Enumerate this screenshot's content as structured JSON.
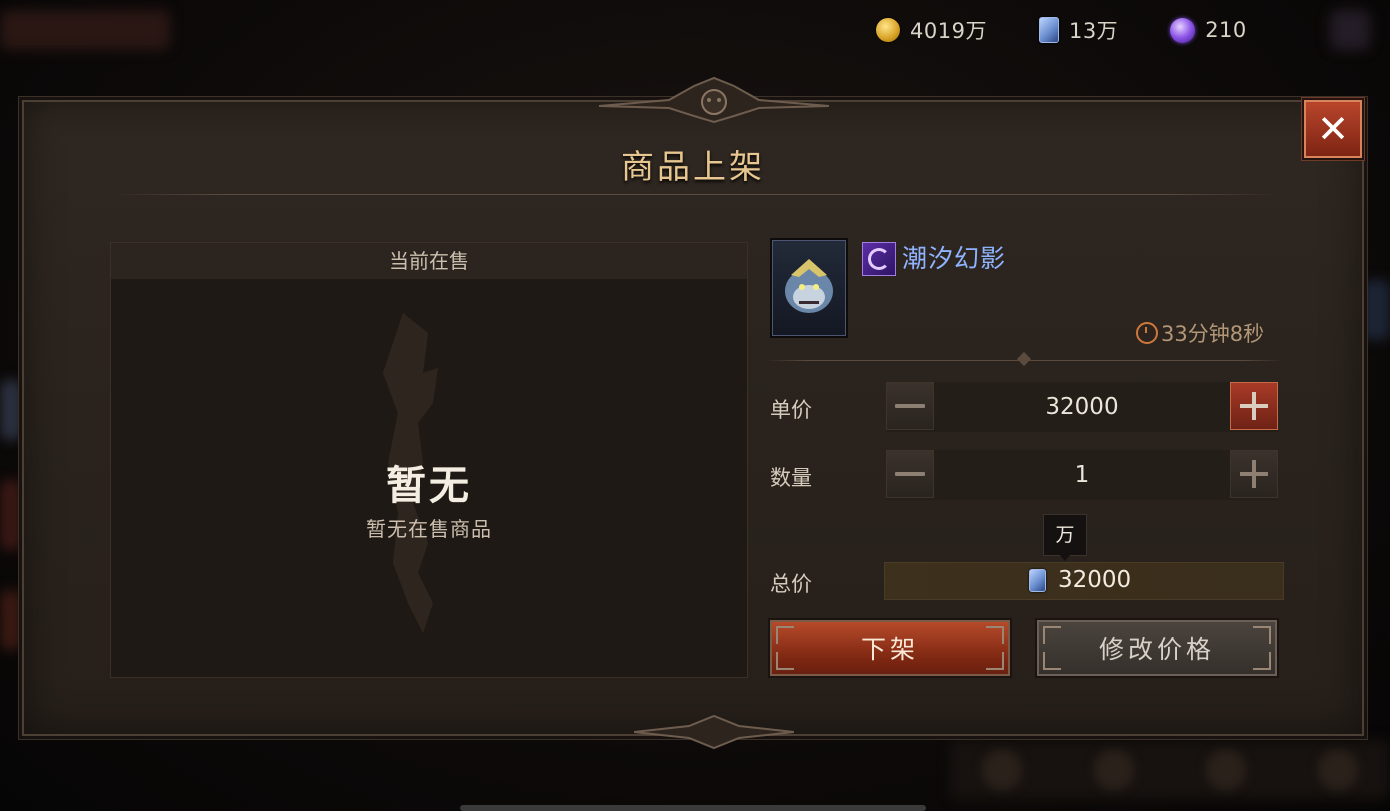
{
  "currencies": [
    {
      "icon": "gold-coin-icon",
      "value": "4019万"
    },
    {
      "icon": "card-currency-icon",
      "value": "13万"
    },
    {
      "icon": "purple-orb-icon",
      "value": "210"
    }
  ],
  "dialog": {
    "title": "商品上架",
    "close_icon": "close-icon",
    "close_label": "✕"
  },
  "current_sale": {
    "header": "当前在售",
    "empty_title": "暂无",
    "empty_subtitle": "暂无在售商品"
  },
  "item": {
    "name": "潮汐幻影",
    "name_color": "#8fb3ff",
    "rarity_icon": "purple-swirl-icon",
    "timer": "33分钟8秒",
    "timer_icon": "clock-icon"
  },
  "pricing": {
    "unit_price_label": "单价",
    "unit_price_value": "32000",
    "quantity_label": "数量",
    "quantity_value": "1",
    "unit_tooltip": "万",
    "total_label": "总价",
    "total_value": "32000",
    "total_currency_icon": "card-currency-icon"
  },
  "actions": {
    "delist_label": "下架",
    "modify_label": "修改价格"
  },
  "colors": {
    "accent_red": "#b64a2a",
    "title_gold": "#e7c68f",
    "item_blue": "#8fb3ff"
  }
}
